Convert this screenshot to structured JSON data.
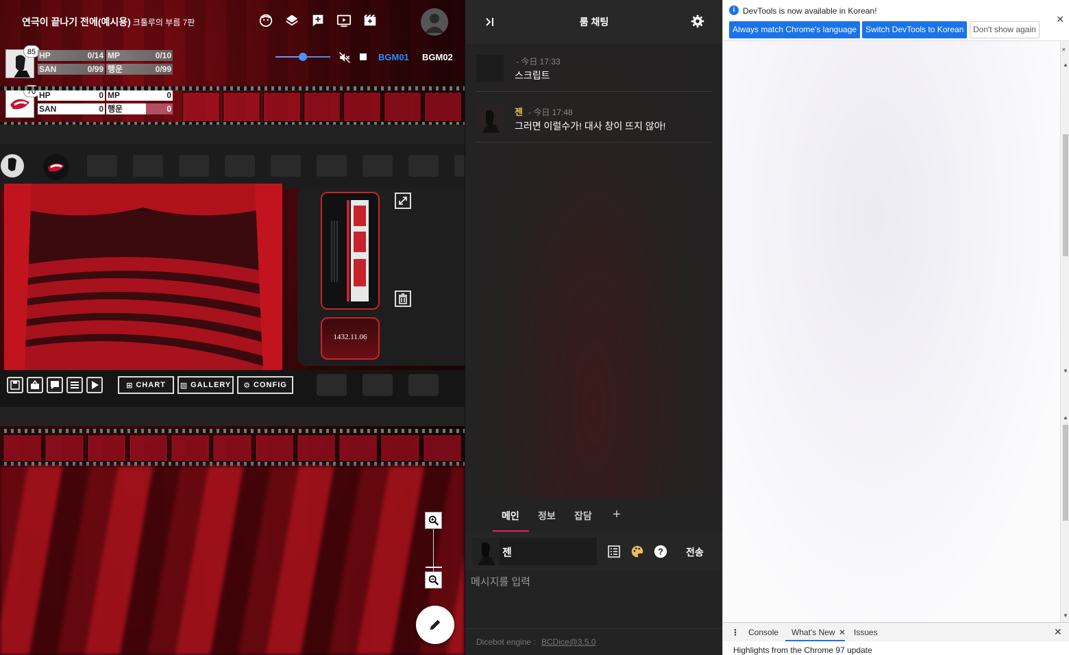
{
  "room": {
    "title": "연극이 끝나기 전에(예시용)",
    "subtitle": "크툴루의 부름 7판"
  },
  "top_icons": [
    "face-icon",
    "layers-icon",
    "add-box-icon",
    "screen-icon",
    "movie-icon",
    "account-icon"
  ],
  "characters": [
    {
      "badge": "85",
      "stats": [
        {
          "label": "HP",
          "value": "0/14"
        },
        {
          "label": "MP",
          "value": "0/10"
        },
        {
          "label": "SAN",
          "value": "0/99"
        },
        {
          "label": "행운",
          "value": "0/99"
        }
      ]
    },
    {
      "badge": "70",
      "stats": [
        {
          "label": "HP",
          "value": "0"
        },
        {
          "label": "MP",
          "value": "0"
        },
        {
          "label": "SAN",
          "value": "0"
        },
        {
          "label": "행운",
          "value": "0"
        }
      ]
    }
  ],
  "audio": {
    "volume": 0.5,
    "bgm1": "BGM01",
    "bgm2": "BGM02",
    "active_color": "#2b8cff"
  },
  "ticket": {
    "date": "1432.11.06"
  },
  "bottom_menu": {
    "chart": "CHART",
    "gallery": "GALLERY",
    "config": "CONFIG"
  },
  "chat": {
    "title": "룸 채팅",
    "messages": [
      {
        "name": "",
        "time": "- today 17:33",
        "time_display": "- 今日 17:33",
        "text": "스크립트"
      },
      {
        "name": "젠",
        "time_display": "- 今日 17:48",
        "text": "그러면 이럴수가! 대사 창이 뜨지 않아!"
      }
    ],
    "tabs": [
      {
        "label": "메인",
        "active": true
      },
      {
        "label": "정보",
        "active": false
      },
      {
        "label": "잡담",
        "active": false
      }
    ],
    "add_tab": "+",
    "sender_name": "젠",
    "send_label": "전송",
    "input_placeholder": "메시지를 입력",
    "footer_label": "Dicebot engine : ",
    "footer_link": "BCDice@3.5.0",
    "accent": "#e0245e"
  },
  "devtools": {
    "info_text": "DevTools is now available in Korean!",
    "btn_match": "Always match Chrome's language",
    "btn_switch": "Switch DevTools to Korean",
    "btn_dont": "Don't show again",
    "close": "✕",
    "drawer_tabs": [
      "Console",
      "What's New",
      "Issues"
    ],
    "whats_new_close": "✕",
    "drawer_close": "✕",
    "highlight": "Highlights from the Chrome 97 update"
  }
}
